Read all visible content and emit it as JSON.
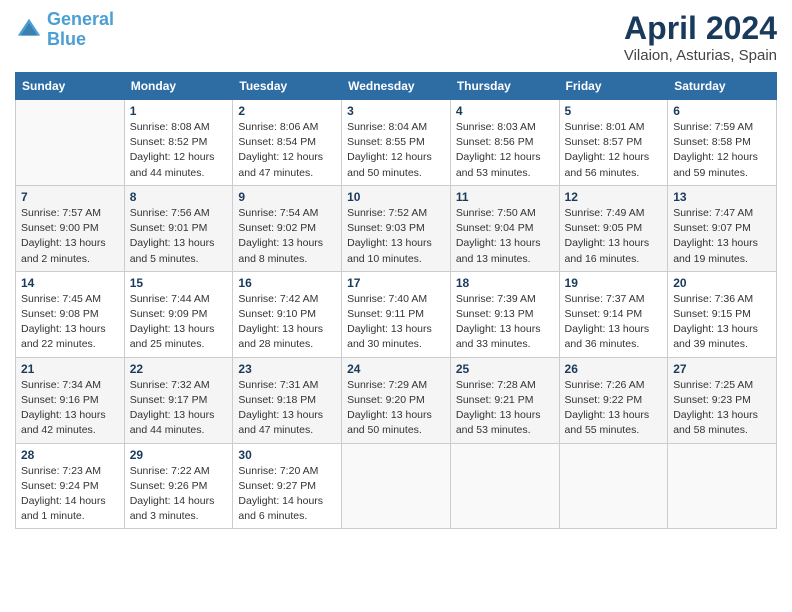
{
  "header": {
    "logo_line1": "General",
    "logo_line2": "Blue",
    "title": "April 2024",
    "subtitle": "Vilaion, Asturias, Spain"
  },
  "weekdays": [
    "Sunday",
    "Monday",
    "Tuesday",
    "Wednesday",
    "Thursday",
    "Friday",
    "Saturday"
  ],
  "weeks": [
    [
      {
        "day": "",
        "info": ""
      },
      {
        "day": "1",
        "info": "Sunrise: 8:08 AM\nSunset: 8:52 PM\nDaylight: 12 hours\nand 44 minutes."
      },
      {
        "day": "2",
        "info": "Sunrise: 8:06 AM\nSunset: 8:54 PM\nDaylight: 12 hours\nand 47 minutes."
      },
      {
        "day": "3",
        "info": "Sunrise: 8:04 AM\nSunset: 8:55 PM\nDaylight: 12 hours\nand 50 minutes."
      },
      {
        "day": "4",
        "info": "Sunrise: 8:03 AM\nSunset: 8:56 PM\nDaylight: 12 hours\nand 53 minutes."
      },
      {
        "day": "5",
        "info": "Sunrise: 8:01 AM\nSunset: 8:57 PM\nDaylight: 12 hours\nand 56 minutes."
      },
      {
        "day": "6",
        "info": "Sunrise: 7:59 AM\nSunset: 8:58 PM\nDaylight: 12 hours\nand 59 minutes."
      }
    ],
    [
      {
        "day": "7",
        "info": "Sunrise: 7:57 AM\nSunset: 9:00 PM\nDaylight: 13 hours\nand 2 minutes."
      },
      {
        "day": "8",
        "info": "Sunrise: 7:56 AM\nSunset: 9:01 PM\nDaylight: 13 hours\nand 5 minutes."
      },
      {
        "day": "9",
        "info": "Sunrise: 7:54 AM\nSunset: 9:02 PM\nDaylight: 13 hours\nand 8 minutes."
      },
      {
        "day": "10",
        "info": "Sunrise: 7:52 AM\nSunset: 9:03 PM\nDaylight: 13 hours\nand 10 minutes."
      },
      {
        "day": "11",
        "info": "Sunrise: 7:50 AM\nSunset: 9:04 PM\nDaylight: 13 hours\nand 13 minutes."
      },
      {
        "day": "12",
        "info": "Sunrise: 7:49 AM\nSunset: 9:05 PM\nDaylight: 13 hours\nand 16 minutes."
      },
      {
        "day": "13",
        "info": "Sunrise: 7:47 AM\nSunset: 9:07 PM\nDaylight: 13 hours\nand 19 minutes."
      }
    ],
    [
      {
        "day": "14",
        "info": "Sunrise: 7:45 AM\nSunset: 9:08 PM\nDaylight: 13 hours\nand 22 minutes."
      },
      {
        "day": "15",
        "info": "Sunrise: 7:44 AM\nSunset: 9:09 PM\nDaylight: 13 hours\nand 25 minutes."
      },
      {
        "day": "16",
        "info": "Sunrise: 7:42 AM\nSunset: 9:10 PM\nDaylight: 13 hours\nand 28 minutes."
      },
      {
        "day": "17",
        "info": "Sunrise: 7:40 AM\nSunset: 9:11 PM\nDaylight: 13 hours\nand 30 minutes."
      },
      {
        "day": "18",
        "info": "Sunrise: 7:39 AM\nSunset: 9:13 PM\nDaylight: 13 hours\nand 33 minutes."
      },
      {
        "day": "19",
        "info": "Sunrise: 7:37 AM\nSunset: 9:14 PM\nDaylight: 13 hours\nand 36 minutes."
      },
      {
        "day": "20",
        "info": "Sunrise: 7:36 AM\nSunset: 9:15 PM\nDaylight: 13 hours\nand 39 minutes."
      }
    ],
    [
      {
        "day": "21",
        "info": "Sunrise: 7:34 AM\nSunset: 9:16 PM\nDaylight: 13 hours\nand 42 minutes."
      },
      {
        "day": "22",
        "info": "Sunrise: 7:32 AM\nSunset: 9:17 PM\nDaylight: 13 hours\nand 44 minutes."
      },
      {
        "day": "23",
        "info": "Sunrise: 7:31 AM\nSunset: 9:18 PM\nDaylight: 13 hours\nand 47 minutes."
      },
      {
        "day": "24",
        "info": "Sunrise: 7:29 AM\nSunset: 9:20 PM\nDaylight: 13 hours\nand 50 minutes."
      },
      {
        "day": "25",
        "info": "Sunrise: 7:28 AM\nSunset: 9:21 PM\nDaylight: 13 hours\nand 53 minutes."
      },
      {
        "day": "26",
        "info": "Sunrise: 7:26 AM\nSunset: 9:22 PM\nDaylight: 13 hours\nand 55 minutes."
      },
      {
        "day": "27",
        "info": "Sunrise: 7:25 AM\nSunset: 9:23 PM\nDaylight: 13 hours\nand 58 minutes."
      }
    ],
    [
      {
        "day": "28",
        "info": "Sunrise: 7:23 AM\nSunset: 9:24 PM\nDaylight: 14 hours\nand 1 minute."
      },
      {
        "day": "29",
        "info": "Sunrise: 7:22 AM\nSunset: 9:26 PM\nDaylight: 14 hours\nand 3 minutes."
      },
      {
        "day": "30",
        "info": "Sunrise: 7:20 AM\nSunset: 9:27 PM\nDaylight: 14 hours\nand 6 minutes."
      },
      {
        "day": "",
        "info": ""
      },
      {
        "day": "",
        "info": ""
      },
      {
        "day": "",
        "info": ""
      },
      {
        "day": "",
        "info": ""
      }
    ]
  ]
}
